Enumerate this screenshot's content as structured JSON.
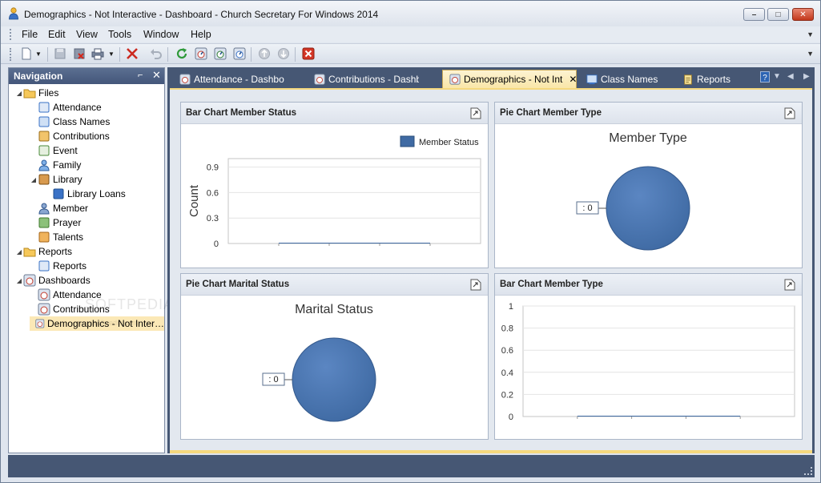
{
  "window": {
    "title": "Demographics - Not Interactive - Dashboard - Church Secretary For Windows 2014",
    "min_symbol": "–",
    "max_symbol": "□",
    "close_symbol": "✕"
  },
  "menu": [
    "File",
    "Edit",
    "View",
    "Tools",
    "Window",
    "Help"
  ],
  "toolbar": {
    "icons": [
      "new-icon",
      "save-icon",
      "delete-record-icon",
      "print-icon",
      "cancel-icon",
      "undo-icon",
      "refresh-icon",
      "dashboard-icon",
      "dashboard-alt-icon",
      "dashboard-settings-icon",
      "back-icon",
      "forward-icon",
      "close-window-icon"
    ]
  },
  "navigation": {
    "title": "Navigation",
    "pin_symbol": "⌐",
    "close_symbol": "✕",
    "tree": [
      {
        "label": "Files",
        "level": 0,
        "expanded": true,
        "icon": "folder-icon"
      },
      {
        "label": "Attendance",
        "level": 1,
        "icon": "attendance-icon"
      },
      {
        "label": "Class Names",
        "level": 1,
        "icon": "class-names-icon"
      },
      {
        "label": "Contributions",
        "level": 1,
        "icon": "contributions-icon"
      },
      {
        "label": "Event",
        "level": 1,
        "icon": "event-icon"
      },
      {
        "label": "Family",
        "level": 1,
        "icon": "family-icon"
      },
      {
        "label": "Library",
        "level": 1,
        "expanded": true,
        "icon": "library-icon"
      },
      {
        "label": "Library Loans",
        "level": 2,
        "icon": "library-loans-icon"
      },
      {
        "label": "Member",
        "level": 1,
        "icon": "member-icon"
      },
      {
        "label": "Prayer",
        "level": 1,
        "icon": "prayer-icon"
      },
      {
        "label": "Talents",
        "level": 1,
        "icon": "talents-icon"
      },
      {
        "label": "Reports",
        "level": 0,
        "expanded": true,
        "icon": "folder-icon"
      },
      {
        "label": "Reports",
        "level": 1,
        "icon": "reports-icon"
      },
      {
        "label": "Dashboards",
        "level": 0,
        "expanded": true,
        "icon": "dashboard-icon"
      },
      {
        "label": "Attendance",
        "level": 1,
        "icon": "dashboard-icon"
      },
      {
        "label": "Contributions",
        "level": 1,
        "icon": "dashboard-icon"
      },
      {
        "label": "Demographics - Not Inter…",
        "level": 1,
        "icon": "dashboard-icon",
        "selected": true
      }
    ]
  },
  "tabs": [
    {
      "label": "Attendance - Dashboar",
      "icon": "dashboard-icon",
      "active": false
    },
    {
      "label": "Contributions - Dashbo",
      "icon": "dashboard-icon",
      "active": false
    },
    {
      "label": "Demographics - Not Int",
      "icon": "dashboard-icon",
      "active": true,
      "close": "✕"
    },
    {
      "label": "Class Names",
      "icon": "class-names-icon",
      "active": false
    },
    {
      "label": "Reports",
      "icon": "reports-icon",
      "active": false
    }
  ],
  "panels": {
    "bar_member_status": "Bar Chart Member Status",
    "pie_member_type": "Pie Chart Member Type",
    "pie_marital_status": "Pie Chart Marital Status",
    "bar_member_type": "Bar Chart Member Type"
  },
  "chart_data": [
    {
      "type": "bar",
      "title": "",
      "ylabel": "Count",
      "xlabel": "",
      "ylim": [
        0,
        1
      ],
      "y_ticks": [
        "0.9",
        "0.6",
        "0.3",
        "0"
      ],
      "legend": "Member Status",
      "legend_position": "top-right",
      "series": [
        {
          "name": "Member Status",
          "values": [
            0
          ]
        }
      ],
      "color": "#3f6aa3"
    },
    {
      "type": "pie",
      "title": "Member Type",
      "slices": [
        {
          "label": ": 0",
          "value": 0
        }
      ],
      "color": "#3f6aa3"
    },
    {
      "type": "pie",
      "title": "Marital Status",
      "slices": [
        {
          "label": ": 0",
          "value": 0
        }
      ],
      "color": "#3f6aa3"
    },
    {
      "type": "bar",
      "title": "",
      "ylabel": "",
      "ylim": [
        0,
        1
      ],
      "y_ticks": [
        "1",
        "0.8",
        "0.6",
        "0.4",
        "0.2",
        "0"
      ],
      "series": [
        {
          "name": "",
          "values": [
            0
          ]
        }
      ],
      "color": "#3f6aa3"
    }
  ],
  "watermark": {
    "text": "SOFTPEDIA®",
    "url": "www.softpedia.com"
  }
}
